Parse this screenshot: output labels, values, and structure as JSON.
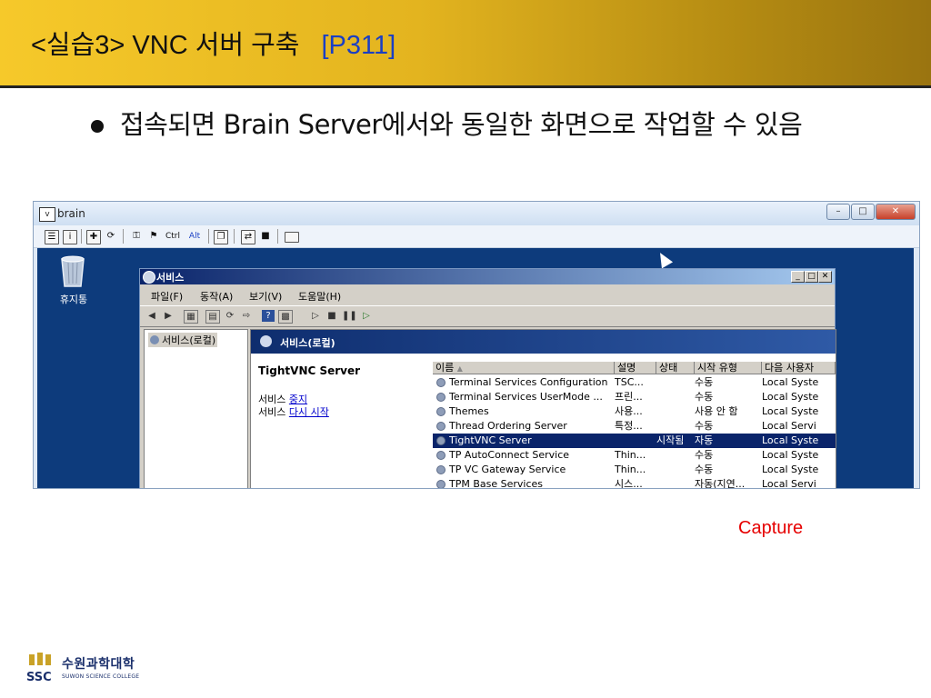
{
  "slide": {
    "title": "<실습3> VNC 서버 구축",
    "page_ref": "[P311]",
    "bullet": "접속되면 Brain Server에서와 동일한 화면으로 작업할 수 있음",
    "capture_label": "Capture"
  },
  "vnc_window": {
    "title": "brain",
    "toolbar": {
      "ctrl_label": "Ctrl",
      "alt_label": "Alt"
    }
  },
  "desktop": {
    "recycle_bin_label": "휴지통"
  },
  "services_window": {
    "title": "서비스",
    "menu": [
      "파일(F)",
      "동작(A)",
      "보기(V)",
      "도움말(H)"
    ],
    "tree_root": "서비스(로컬)",
    "detail_header": "서비스(로컬)",
    "selected_service": "TightVNC Server",
    "action_stop_prefix": "서비스 ",
    "action_stop_link": "중지",
    "action_restart_prefix": "서비스 ",
    "action_restart_link": "다시 시작",
    "columns": [
      "이름",
      "설명",
      "상태",
      "시작 유형",
      "다음 사용자"
    ],
    "rows": [
      {
        "name": "Terminal Services Configuration",
        "desc": "TSC...",
        "status": "",
        "startup": "수동",
        "logon": "Local Syste"
      },
      {
        "name": "Terminal Services UserMode ...",
        "desc": "프린...",
        "status": "",
        "startup": "수동",
        "logon": "Local Syste"
      },
      {
        "name": "Themes",
        "desc": "사용...",
        "status": "",
        "startup": "사용 안 함",
        "logon": "Local Syste"
      },
      {
        "name": "Thread Ordering Server",
        "desc": "특정...",
        "status": "",
        "startup": "수동",
        "logon": "Local Servi"
      },
      {
        "name": "TightVNC Server",
        "desc": "",
        "status": "시작됨",
        "startup": "자동",
        "logon": "Local Syste"
      },
      {
        "name": "TP AutoConnect Service",
        "desc": "Thin...",
        "status": "",
        "startup": "수동",
        "logon": "Local Syste"
      },
      {
        "name": "TP VC Gateway Service",
        "desc": "Thin...",
        "status": "",
        "startup": "수동",
        "logon": "Local Syste"
      },
      {
        "name": "TPM Base Services",
        "desc": "시스...",
        "status": "",
        "startup": "자동(지연...",
        "logon": "Local Servi"
      }
    ],
    "selected_row_index": 4
  },
  "logo": {
    "korean_name": "수원과학대학",
    "english_name": "SUWON SCIENCE COLLEGE"
  }
}
